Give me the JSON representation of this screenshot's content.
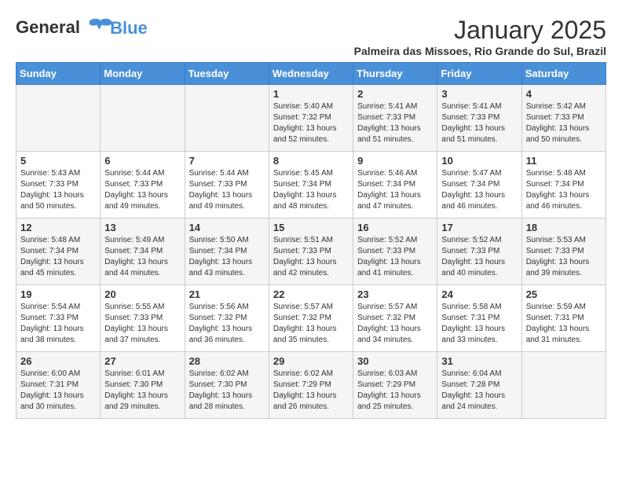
{
  "logo": {
    "line1": "General",
    "line2": "Blue"
  },
  "title": "January 2025",
  "subtitle": "Palmeira das Missoes, Rio Grande do Sul, Brazil",
  "days_of_week": [
    "Sunday",
    "Monday",
    "Tuesday",
    "Wednesday",
    "Thursday",
    "Friday",
    "Saturday"
  ],
  "weeks": [
    [
      {
        "day": "",
        "info": ""
      },
      {
        "day": "",
        "info": ""
      },
      {
        "day": "",
        "info": ""
      },
      {
        "day": "1",
        "info": "Sunrise: 5:40 AM\nSunset: 7:32 PM\nDaylight: 13 hours and 52 minutes."
      },
      {
        "day": "2",
        "info": "Sunrise: 5:41 AM\nSunset: 7:33 PM\nDaylight: 13 hours and 51 minutes."
      },
      {
        "day": "3",
        "info": "Sunrise: 5:41 AM\nSunset: 7:33 PM\nDaylight: 13 hours and 51 minutes."
      },
      {
        "day": "4",
        "info": "Sunrise: 5:42 AM\nSunset: 7:33 PM\nDaylight: 13 hours and 50 minutes."
      }
    ],
    [
      {
        "day": "5",
        "info": "Sunrise: 5:43 AM\nSunset: 7:33 PM\nDaylight: 13 hours and 50 minutes."
      },
      {
        "day": "6",
        "info": "Sunrise: 5:44 AM\nSunset: 7:33 PM\nDaylight: 13 hours and 49 minutes."
      },
      {
        "day": "7",
        "info": "Sunrise: 5:44 AM\nSunset: 7:33 PM\nDaylight: 13 hours and 49 minutes."
      },
      {
        "day": "8",
        "info": "Sunrise: 5:45 AM\nSunset: 7:34 PM\nDaylight: 13 hours and 48 minutes."
      },
      {
        "day": "9",
        "info": "Sunrise: 5:46 AM\nSunset: 7:34 PM\nDaylight: 13 hours and 47 minutes."
      },
      {
        "day": "10",
        "info": "Sunrise: 5:47 AM\nSunset: 7:34 PM\nDaylight: 13 hours and 46 minutes."
      },
      {
        "day": "11",
        "info": "Sunrise: 5:48 AM\nSunset: 7:34 PM\nDaylight: 13 hours and 46 minutes."
      }
    ],
    [
      {
        "day": "12",
        "info": "Sunrise: 5:48 AM\nSunset: 7:34 PM\nDaylight: 13 hours and 45 minutes."
      },
      {
        "day": "13",
        "info": "Sunrise: 5:49 AM\nSunset: 7:34 PM\nDaylight: 13 hours and 44 minutes."
      },
      {
        "day": "14",
        "info": "Sunrise: 5:50 AM\nSunset: 7:34 PM\nDaylight: 13 hours and 43 minutes."
      },
      {
        "day": "15",
        "info": "Sunrise: 5:51 AM\nSunset: 7:33 PM\nDaylight: 13 hours and 42 minutes."
      },
      {
        "day": "16",
        "info": "Sunrise: 5:52 AM\nSunset: 7:33 PM\nDaylight: 13 hours and 41 minutes."
      },
      {
        "day": "17",
        "info": "Sunrise: 5:52 AM\nSunset: 7:33 PM\nDaylight: 13 hours and 40 minutes."
      },
      {
        "day": "18",
        "info": "Sunrise: 5:53 AM\nSunset: 7:33 PM\nDaylight: 13 hours and 39 minutes."
      }
    ],
    [
      {
        "day": "19",
        "info": "Sunrise: 5:54 AM\nSunset: 7:33 PM\nDaylight: 13 hours and 38 minutes."
      },
      {
        "day": "20",
        "info": "Sunrise: 5:55 AM\nSunset: 7:33 PM\nDaylight: 13 hours and 37 minutes."
      },
      {
        "day": "21",
        "info": "Sunrise: 5:56 AM\nSunset: 7:32 PM\nDaylight: 13 hours and 36 minutes."
      },
      {
        "day": "22",
        "info": "Sunrise: 5:57 AM\nSunset: 7:32 PM\nDaylight: 13 hours and 35 minutes."
      },
      {
        "day": "23",
        "info": "Sunrise: 5:57 AM\nSunset: 7:32 PM\nDaylight: 13 hours and 34 minutes."
      },
      {
        "day": "24",
        "info": "Sunrise: 5:58 AM\nSunset: 7:31 PM\nDaylight: 13 hours and 33 minutes."
      },
      {
        "day": "25",
        "info": "Sunrise: 5:59 AM\nSunset: 7:31 PM\nDaylight: 13 hours and 31 minutes."
      }
    ],
    [
      {
        "day": "26",
        "info": "Sunrise: 6:00 AM\nSunset: 7:31 PM\nDaylight: 13 hours and 30 minutes."
      },
      {
        "day": "27",
        "info": "Sunrise: 6:01 AM\nSunset: 7:30 PM\nDaylight: 13 hours and 29 minutes."
      },
      {
        "day": "28",
        "info": "Sunrise: 6:02 AM\nSunset: 7:30 PM\nDaylight: 13 hours and 28 minutes."
      },
      {
        "day": "29",
        "info": "Sunrise: 6:02 AM\nSunset: 7:29 PM\nDaylight: 13 hours and 26 minutes."
      },
      {
        "day": "30",
        "info": "Sunrise: 6:03 AM\nSunset: 7:29 PM\nDaylight: 13 hours and 25 minutes."
      },
      {
        "day": "31",
        "info": "Sunrise: 6:04 AM\nSunset: 7:28 PM\nDaylight: 13 hours and 24 minutes."
      },
      {
        "day": "",
        "info": ""
      }
    ]
  ]
}
